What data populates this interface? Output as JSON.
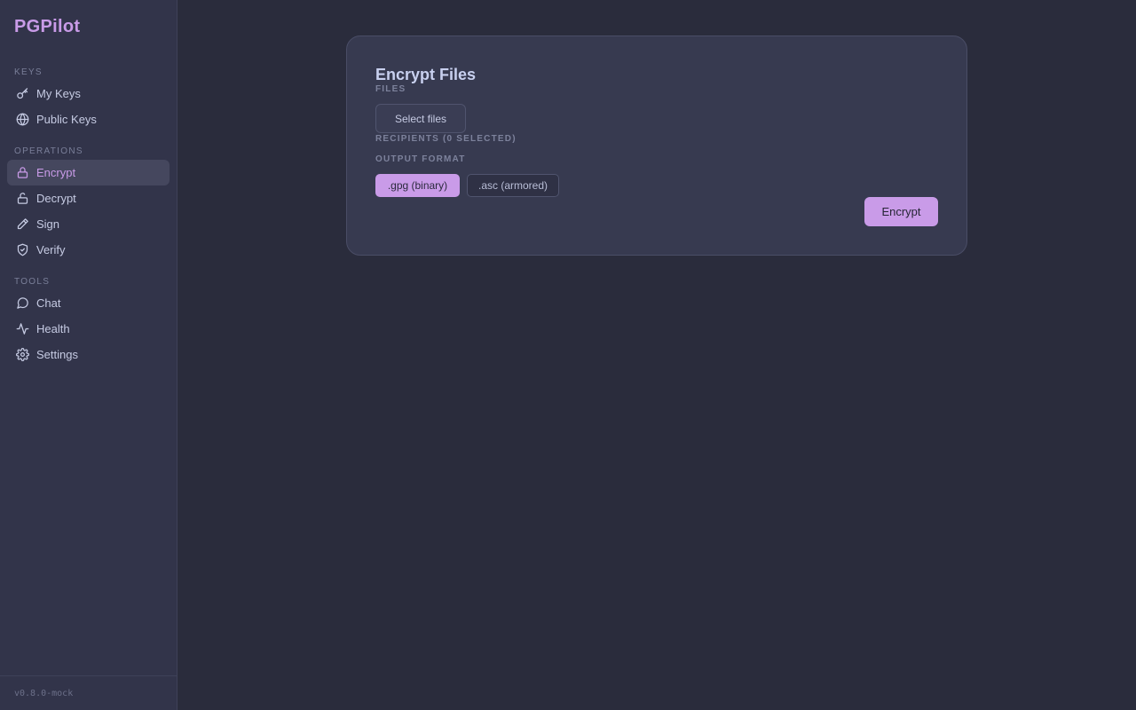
{
  "app": {
    "name": "PGPilot",
    "version": "v0.8.0-mock"
  },
  "sidebar": {
    "sections": [
      {
        "label": "KEYS"
      },
      {
        "label": "OPERATIONS"
      },
      {
        "label": "TOOLS"
      }
    ],
    "items": [
      {
        "label": "My Keys",
        "icon": "key-icon"
      },
      {
        "label": "Public Keys",
        "icon": "globe-icon"
      },
      {
        "label": "Encrypt",
        "icon": "lock-icon",
        "active": true
      },
      {
        "label": "Decrypt",
        "icon": "unlock-icon"
      },
      {
        "label": "Sign",
        "icon": "pen-icon"
      },
      {
        "label": "Verify",
        "icon": "shield-check-icon"
      },
      {
        "label": "Chat",
        "icon": "chat-bubble-icon"
      },
      {
        "label": "Health",
        "icon": "activity-icon"
      },
      {
        "label": "Settings",
        "icon": "gear-icon"
      }
    ]
  },
  "encrypt": {
    "title": "Encrypt Files",
    "files_label": "FILES",
    "select_files_label": "Select files",
    "recipients_label": "RECIPIENTS (0 SELECTED)",
    "output_format_label": "OUTPUT FORMAT",
    "formats": [
      {
        "label": ".gpg (binary)",
        "selected": true
      },
      {
        "label": ".asc (armored)",
        "selected": false
      }
    ],
    "submit_label": "Encrypt"
  },
  "colors": {
    "accent": "#c99be8",
    "background": "#2a2c3c",
    "sidebar": "#32344a",
    "card": "#373a50"
  }
}
